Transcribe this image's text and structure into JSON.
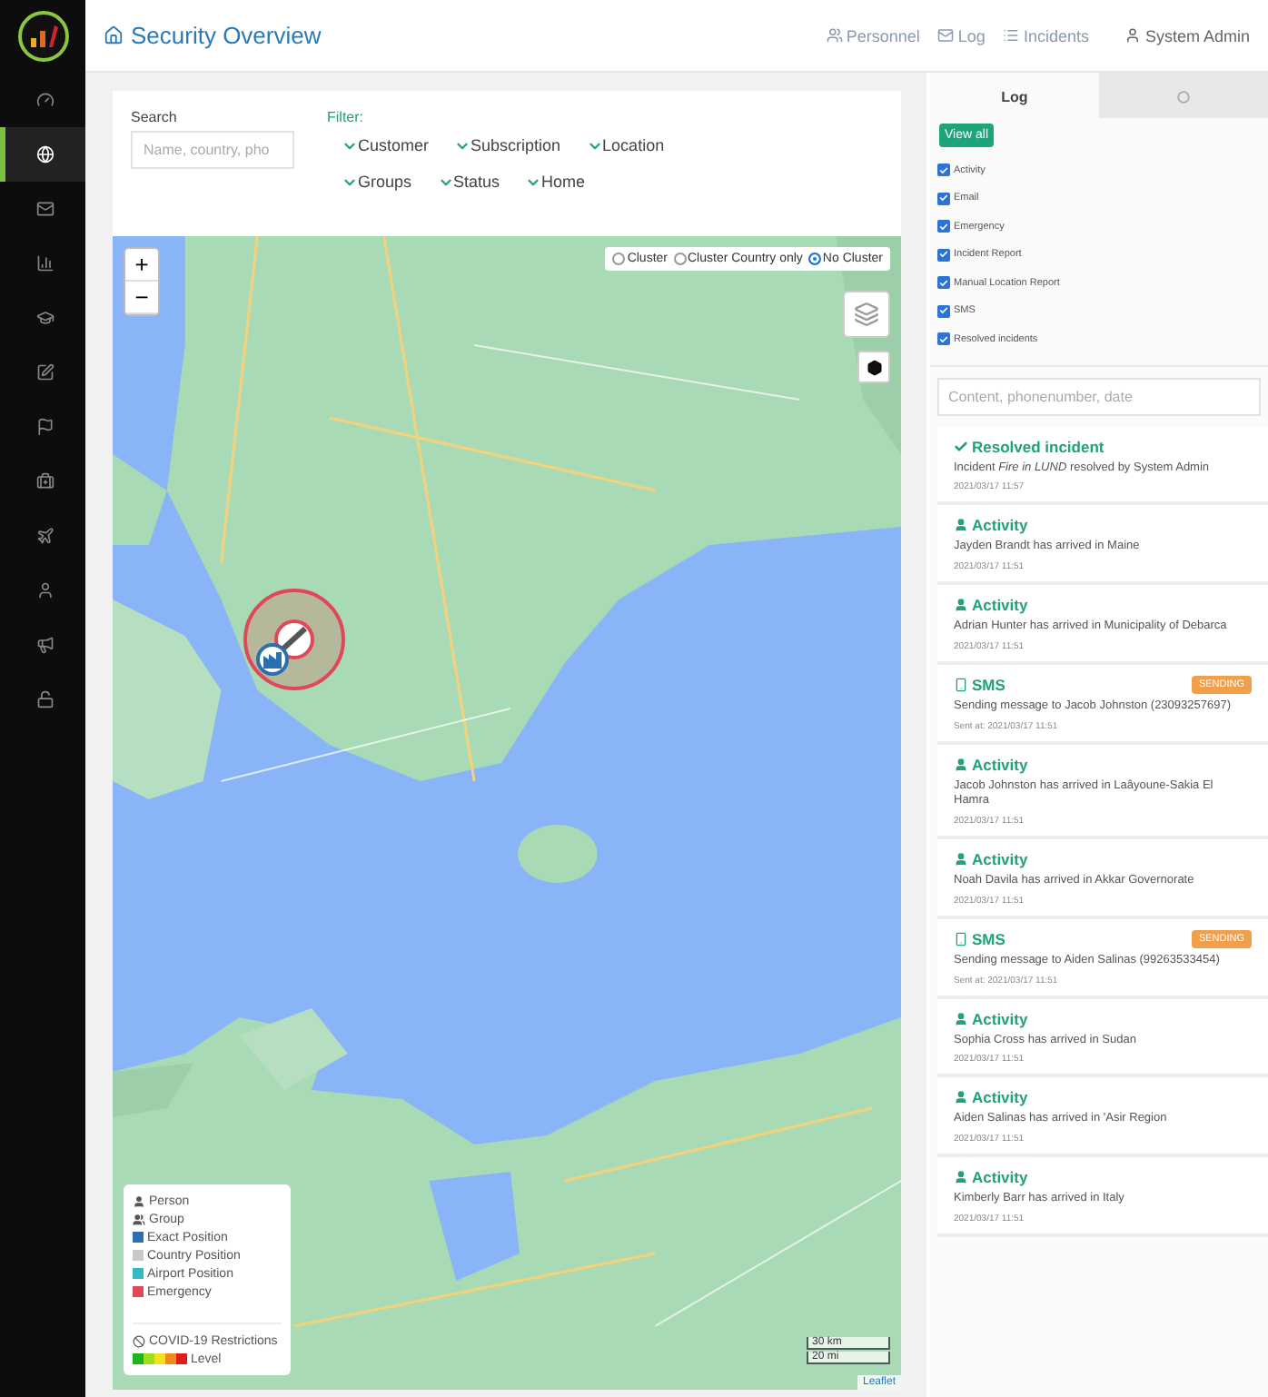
{
  "header": {
    "title": "Security Overview",
    "nav": [
      {
        "kind": "users",
        "label": "Personnel"
      },
      {
        "kind": "mail",
        "label": "Log"
      },
      {
        "kind": "list",
        "label": "Incidents"
      }
    ],
    "user": "System Admin"
  },
  "sidebar": {
    "items": [
      {
        "kind": "gauge",
        "selected": false
      },
      {
        "kind": "globe",
        "selected": true
      },
      {
        "kind": "mail",
        "selected": false
      },
      {
        "kind": "chart",
        "selected": false
      },
      {
        "kind": "cap",
        "selected": false
      },
      {
        "kind": "edit",
        "selected": false
      },
      {
        "kind": "flag",
        "selected": false
      },
      {
        "kind": "medkit",
        "selected": false
      },
      {
        "kind": "plane",
        "selected": false
      },
      {
        "kind": "user",
        "selected": false
      },
      {
        "kind": "megaphone",
        "selected": false
      },
      {
        "kind": "unlock",
        "selected": false
      }
    ]
  },
  "filters": {
    "search_label": "Search",
    "search_placeholder": "Name, country, pho",
    "filter_label": "Filter:",
    "rows": [
      [
        "Customer",
        "Subscription",
        "Location"
      ],
      [
        "Groups",
        "Status",
        "Home"
      ]
    ]
  },
  "map": {
    "zoom": [
      "+",
      "−"
    ],
    "cluster": [
      {
        "label": "Cluster",
        "selected": false
      },
      {
        "label": "Cluster Country only",
        "selected": false
      },
      {
        "label": "No Cluster",
        "selected": true
      }
    ],
    "legend": [
      {
        "kind": "person",
        "label": "Person"
      },
      {
        "kind": "group",
        "label": "Group"
      },
      {
        "kind": "swatch",
        "label": "Exact Position",
        "color": "#2b6fb0"
      },
      {
        "kind": "swatch",
        "label": "Country Position",
        "color": "#c8c8c8"
      },
      {
        "kind": "swatch",
        "label": "Airport Position",
        "color": "#35b9c0"
      },
      {
        "kind": "swatch",
        "label": "Emergency",
        "color": "#e0485a"
      }
    ],
    "covid": "COVID-19 Restrictions",
    "level_label": "Level",
    "scale": [
      "30 km",
      "20 mi"
    ],
    "attribution": "Leaflet"
  },
  "log": {
    "tabs": [
      {
        "kind": "text",
        "label": "Log",
        "selected": true
      },
      {
        "kind": "settings",
        "selected": false
      }
    ],
    "view_all": "View all",
    "types": [
      {
        "label": "Activity",
        "checked": true
      },
      {
        "label": "Email",
        "checked": true
      },
      {
        "label": "Emergency",
        "checked": true
      },
      {
        "label": "Incident Report",
        "checked": true
      },
      {
        "label": "Manual Location Report",
        "checked": true
      },
      {
        "label": "SMS",
        "checked": true
      },
      {
        "label": "Resolved incidents",
        "checked": true
      }
    ],
    "search_placeholder": "Content, phonenumber, date",
    "entries": [
      {
        "kind": "resolved",
        "title": "Resolved incident",
        "text": "Incident *Fire in LUND* resolved by System Admin",
        "date": "2021/03/17 11:57"
      },
      {
        "kind": "activity",
        "title": "Activity",
        "text": "Jayden Brandt has arrived in Maine",
        "date": "2021/03/17 11:51"
      },
      {
        "kind": "activity",
        "title": "Activity",
        "text": "Adrian Hunter has arrived in Municipality of Debarca",
        "date": "2021/03/17 11:51"
      },
      {
        "kind": "sms",
        "title": "SMS",
        "badge": "SENDING",
        "text": "Sending message to Jacob Johnston (23093257697)",
        "date": "Sent at: 2021/03/17 11:51"
      },
      {
        "kind": "activity",
        "title": "Activity",
        "text": "Jacob Johnston has arrived in Laâyoune-Sakia El Hamra",
        "date": "2021/03/17 11:51"
      },
      {
        "kind": "activity",
        "title": "Activity",
        "text": "Noah Davila has arrived in Akkar Governorate",
        "date": "2021/03/17 11:51"
      },
      {
        "kind": "sms",
        "title": "SMS",
        "badge": "SENDING",
        "text": "Sending message to Aiden Salinas (99263533454)",
        "date": "Sent at: 2021/03/17 11:51"
      },
      {
        "kind": "activity",
        "title": "Activity",
        "text": "Sophia Cross has arrived in Sudan",
        "date": "2021/03/17 11:51"
      },
      {
        "kind": "activity",
        "title": "Activity",
        "text": "Aiden Salinas has arrived in 'Asir Region",
        "date": "2021/03/17 11:51"
      },
      {
        "kind": "activity",
        "title": "Activity",
        "text": "Kimberly Barr has arrived in Italy",
        "date": "2021/03/17 11:51"
      }
    ]
  }
}
